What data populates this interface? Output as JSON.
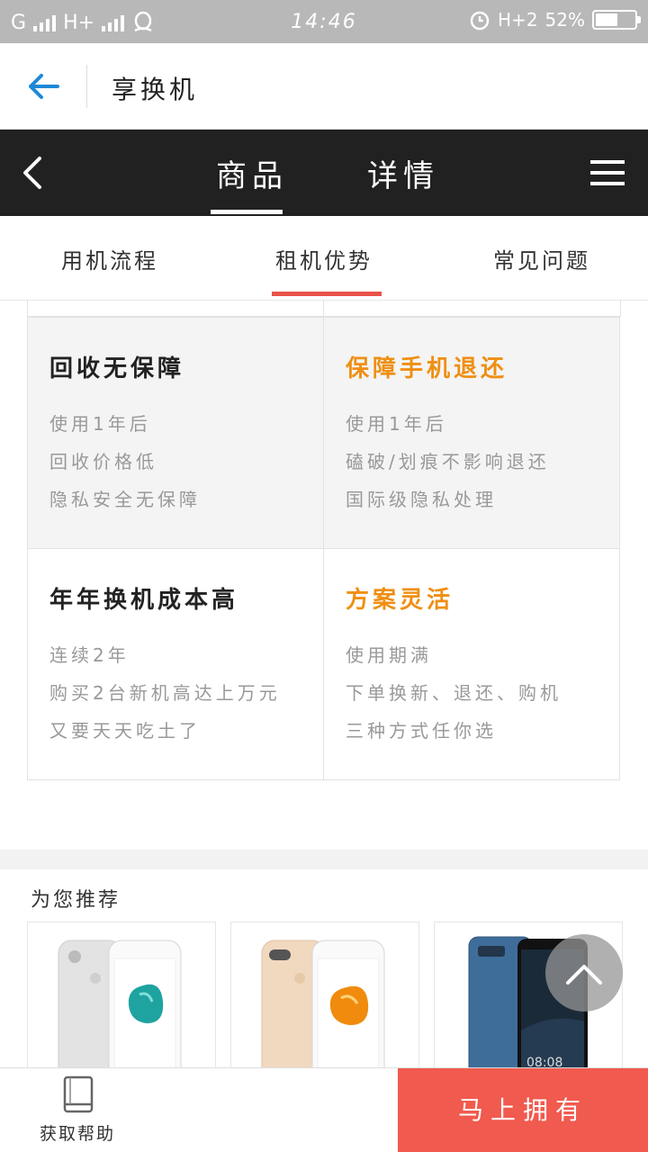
{
  "status_bar": {
    "carrier1": "G",
    "carrier2": "H+",
    "time": "14:46",
    "network": "H+2",
    "battery_text": "52%",
    "battery_level": 0.52
  },
  "header": {
    "title": "享换机"
  },
  "main_nav": {
    "tabs": [
      {
        "label": "商品",
        "active": true
      },
      {
        "label": "详情",
        "active": false
      }
    ]
  },
  "sub_tabs": [
    {
      "label": "用机流程",
      "active": false
    },
    {
      "label": "租机优势",
      "active": true
    },
    {
      "label": "常见问题",
      "active": false
    }
  ],
  "comparison": {
    "rows": [
      {
        "left": {
          "title": "回收无保障",
          "lines": [
            "使用1年后",
            "回收价格低",
            "隐私安全无保障"
          ]
        },
        "right": {
          "title": "保障手机退还",
          "lines": [
            "使用1年后",
            "磕破/划痕不影响退还",
            "国际级隐私处理"
          ]
        }
      },
      {
        "left": {
          "title": "年年换机成本高",
          "lines": [
            "连续2年",
            "购买2台新机高达上万元",
            "又要天天吃土了"
          ]
        },
        "right": {
          "title": "方案灵活",
          "lines": [
            "使用期满",
            "下单换新、退还、购机",
            "三种方式任你选"
          ]
        }
      }
    ]
  },
  "recommend": {
    "title": "为您推荐"
  },
  "bottom": {
    "help_label": "获取帮助",
    "buy_label": "马上拥有"
  },
  "colors": {
    "accent_red": "#f15a4e",
    "orange": "#ef8f13",
    "dark_nav": "#212121",
    "blue_back": "#1e88d8"
  }
}
